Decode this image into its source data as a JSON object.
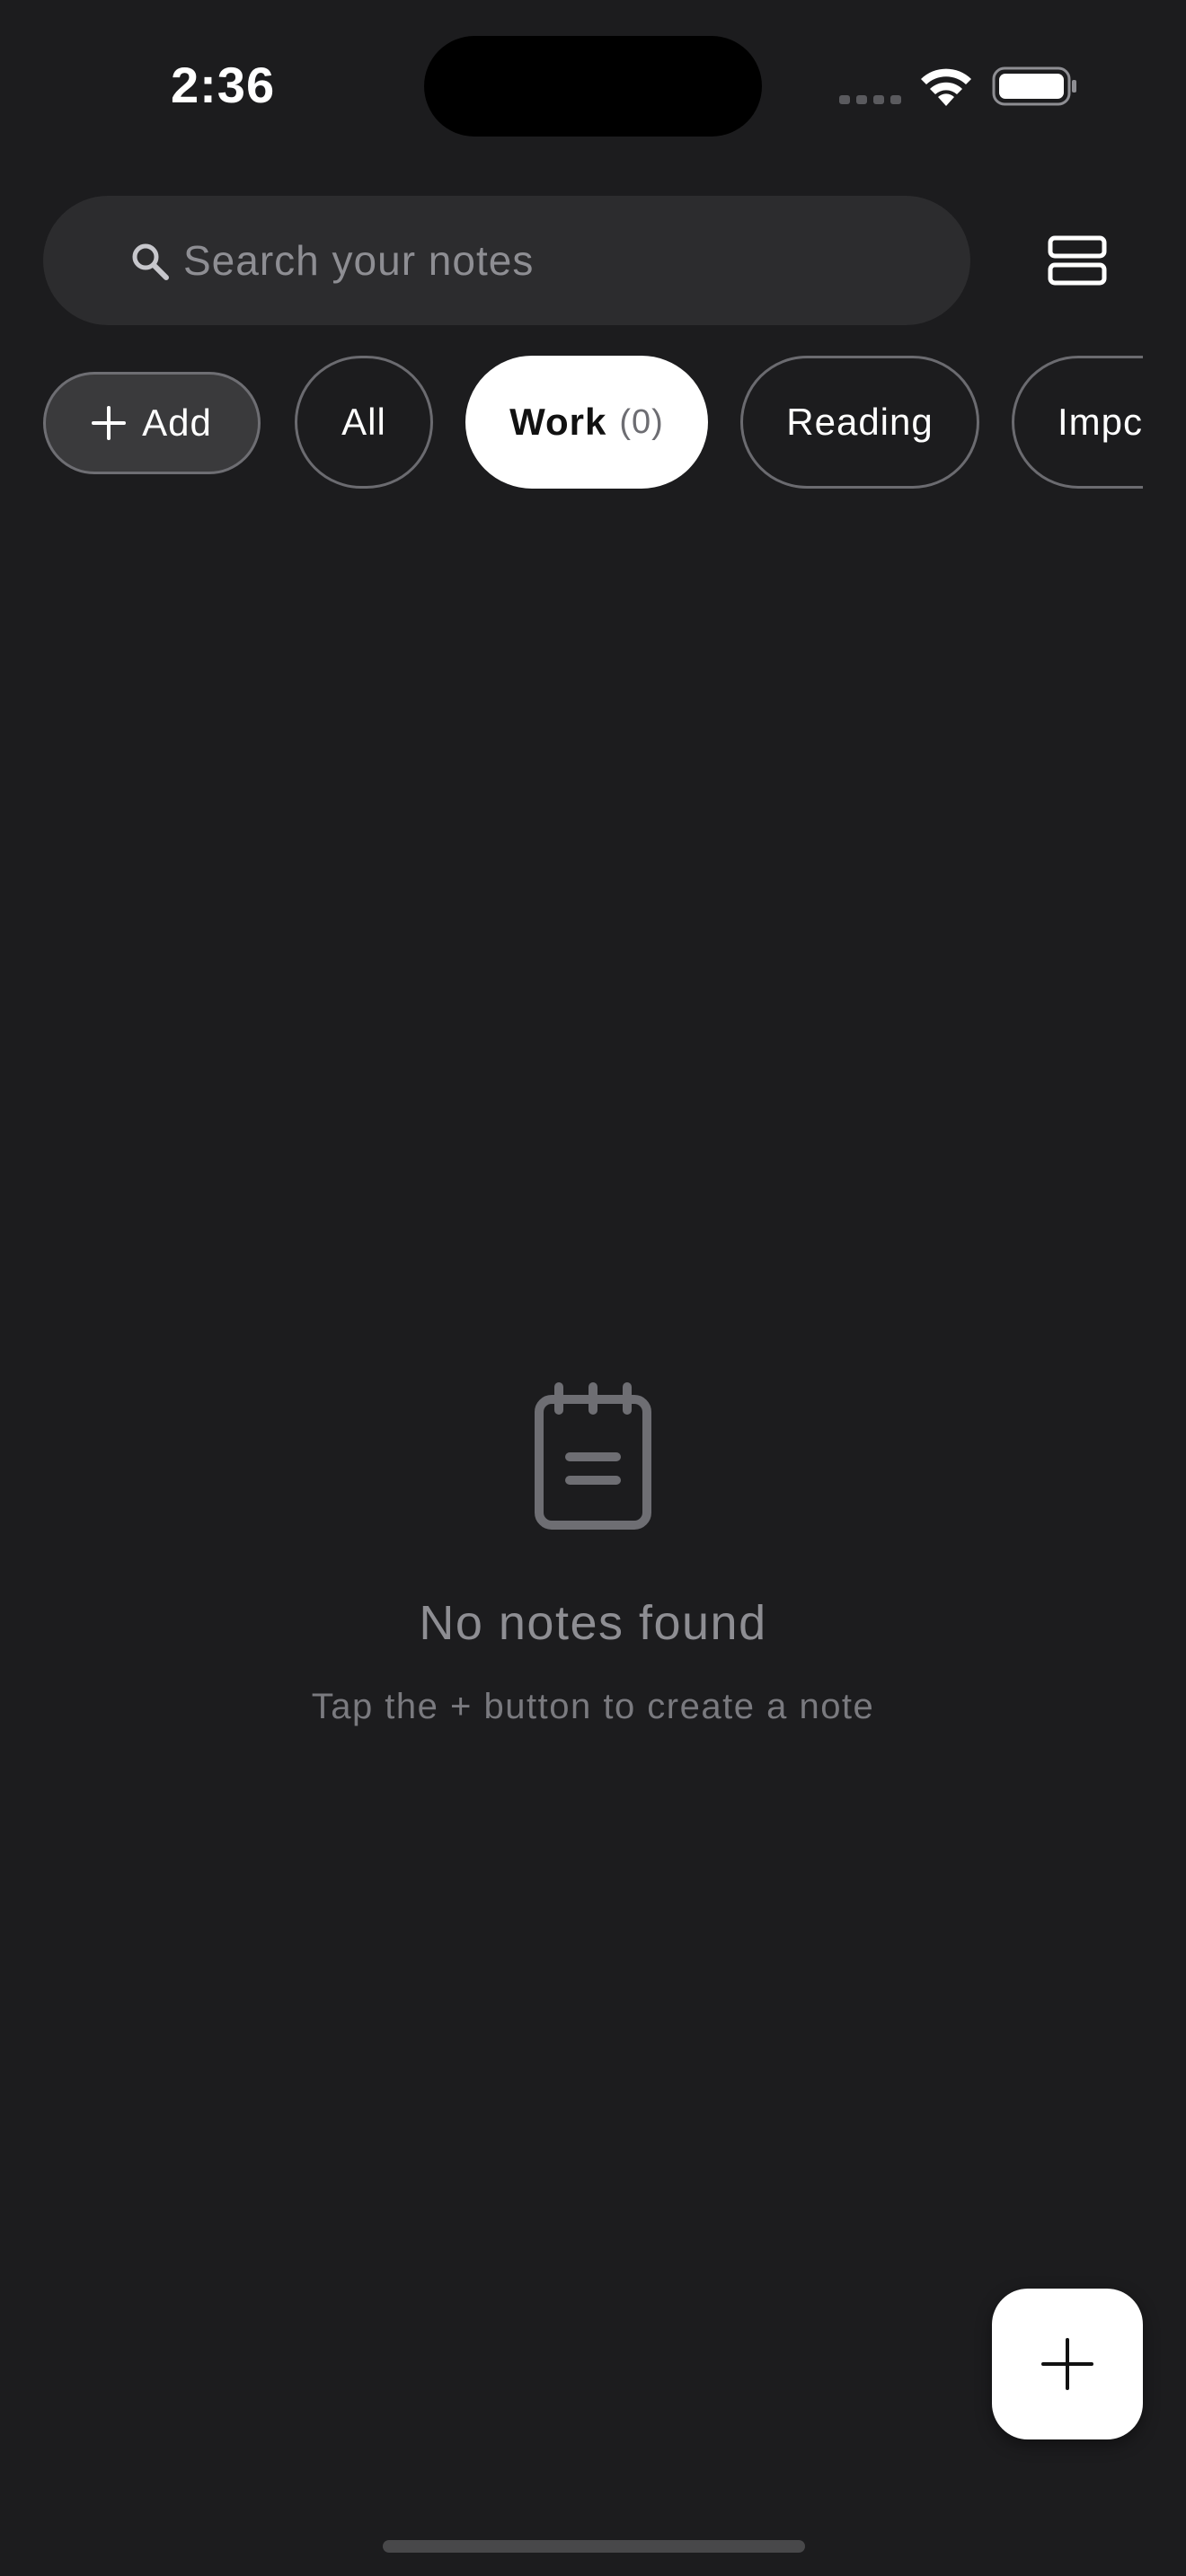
{
  "status_bar": {
    "time": "2:36"
  },
  "search": {
    "placeholder": "Search your notes",
    "value": ""
  },
  "filters": {
    "add_label": "Add",
    "chips": [
      {
        "label": "All"
      },
      {
        "label": "Work",
        "count": "(0)",
        "selected": true
      },
      {
        "label": "Reading"
      },
      {
        "label": "Impc"
      }
    ]
  },
  "empty_state": {
    "title": "No notes found",
    "subtitle": "Tap the + button to create a note"
  },
  "colors": {
    "background": "#1c1c1e",
    "search_background": "#2c2c2e",
    "selected_chip": "#ffffff",
    "muted_text": "#8e8e93"
  },
  "icons": {
    "search": "search-icon",
    "layout": "view-agenda-icon",
    "add": "plus-icon",
    "empty": "notepad-icon",
    "fab": "plus-icon"
  }
}
